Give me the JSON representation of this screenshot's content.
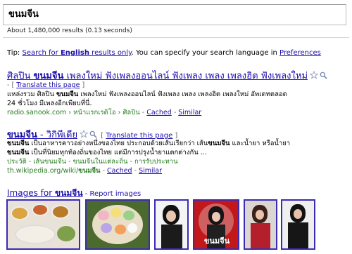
{
  "search": {
    "query": "ขนมจีน"
  },
  "stats": {
    "text": "About 1,480,000 results (0.13 seconds)"
  },
  "tip": {
    "label": "Tip:",
    "link_prefix": "Search for ",
    "link_bold": "English",
    "link_suffix": " results only",
    "middle": ". You can specify your search language in ",
    "prefs_link": "Preferences"
  },
  "results": [
    {
      "title_1": "ศิลปิน ",
      "title_bold": "ขนมจีน",
      "title_2": " เพลงใหม่ ฟังเพลงออนไลน์ ฟังเพลง เพลง เพลงฮิต ฟังเพลงใหม่",
      "translate_pre": "- [ ",
      "translate": "Translate this page",
      "translate_post": " ]",
      "snippet1_1": "แหล่งรวม ศิลปิน ",
      "snippet1_bold": "ขนมจีน",
      "snippet1_2": " เพลงใหม่ ฟังเพลงออนไลน์ ฟังเพลง เพลง เพลงฮิต เพลงใหม่ อัพเดทตลอด",
      "snippet2": "24 ชั่วโมง มีเพลงอีกเพียบที่นี่.",
      "url": "radio.sanook.com › หน้าแรกเรดิโอ › ศิลปิน",
      "cached": "Cached",
      "sep": " - ",
      "similar": "Similar"
    },
    {
      "title_bold": "ขนมจีน",
      "title_2": " - วิกิพีเดีย",
      "translate_pre": "[ ",
      "translate": "Translate this page",
      "translate_post": " ]",
      "snippet1_bold": "ขนมจีน",
      "snippet1_2": " เป็นอาหารคาวอย่างหนึ่งของไทย ประกอบด้วยเส้นเรียกว่า เส้น",
      "snippet1_bold2": "ขนมจีน",
      "snippet1_3": " และน้ำยา หรือน้ำยา",
      "snippet2_bold": "ขนมจีน",
      "snippet2_2": " เป็นที่นิยมทุกท้องถิ่นของไทย แต่มีการปรุงน้ำยาแตกต่างกัน ...",
      "sitelinks": [
        "ประวัติ",
        "เส้นขนมจีน",
        "ขนมจีนในแต่ละถิ่น",
        "การรับประทาน"
      ],
      "url_1": "th.wikipedia.org/wiki/",
      "url_bold": "ขนมจีน",
      "cached": "Cached",
      "sep": " - ",
      "similar": "Similar"
    }
  ],
  "images": {
    "title_1": "Images for ",
    "title_bold": "ขนมจีน",
    "sep": " - ",
    "report": "Report images",
    "thumb_logo_text": "ขนมจีน"
  },
  "colors": {
    "link": "#1a0dab",
    "url_green": "#2a7e24",
    "thumb_border": "#3a2bb5"
  }
}
